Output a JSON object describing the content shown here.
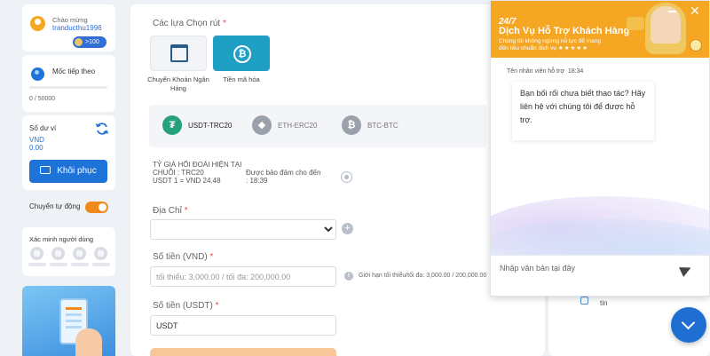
{
  "user": {
    "greeting": "Chào mừng",
    "username": "tranducthu1996",
    "vip_badge": ">100"
  },
  "milestone": {
    "label": "Mốc tiếp theo",
    "progress_text": "0 / 50000",
    "progress_fraction": 0
  },
  "wallet": {
    "label": "Số dư ví",
    "currency": "VND",
    "amount": "0.00",
    "restore_label": "Khôi phục"
  },
  "auto_transfer": {
    "label": "Chuyển tự động",
    "enabled": true
  },
  "verification": {
    "label": "Xác minh người dùng"
  },
  "withdraw": {
    "choose_label": "Các lựa Chọn rút",
    "required_mark": "*",
    "methods": [
      {
        "label": "Chuyển Khoản Ngân Hàng",
        "icon": "bank-icon",
        "active": false
      },
      {
        "label": "Tiền mã hóa",
        "icon": "bitcoin-icon",
        "active": true
      }
    ],
    "chains": [
      {
        "label": "USDT-TRC20",
        "icon": "tether-icon",
        "symbol": "₮",
        "color": "#26a17b"
      },
      {
        "label": "ETH-ERC20",
        "icon": "ethereum-icon",
        "symbol": "◆",
        "color": "#9aa1ab"
      },
      {
        "label": "BTC-BTC",
        "icon": "bitcoin-icon",
        "symbol": "₿",
        "color": "#9aa1ab"
      }
    ],
    "rate_title": "TỶ GIÁ HỐI ĐOÁI HIỆN TẠI",
    "rate_chain": "CHUỖI : TRC20",
    "rate_value": "USDT 1 = VND 24.48",
    "guarantee_label": "Được bảo đảm cho đến",
    "guarantee_time": ": 18:39",
    "address_label": "Địa Chỉ",
    "amount_vnd_label": "Số tiền (VND)",
    "amount_vnd_placeholder": "tối thiểu: 3,000.00 / tối đa: 200,000.00",
    "limits_text": "Giới hạn tối thiểu/tối đa: 3,000.00 / 200,000.00",
    "amount_usdt_label": "Số tiền (USDT)",
    "amount_usdt_value": "USDT"
  },
  "right_card": {
    "partial_text": "tin"
  },
  "chat": {
    "tagline": "24/7",
    "title": "Dịch Vụ Hỗ Trợ Khách Hàng",
    "subtitle": "Chúng tôi không ngừng nỗ lực để mang đến tiêu chuẩn dịch vụ",
    "stars": "★★★★★",
    "minimize_icon": "minimize-icon",
    "close_symbol": "✕",
    "agent_label": "Tên nhân viên hỗ trợ",
    "agent_time": "18:34",
    "message": "Bạn bối rối chưa biết thao tác? Hãy liên hệ với chúng tôi để được hỗ trợ.",
    "input_placeholder": "Nhập văn bản tại đây"
  },
  "colors": {
    "primary": "#1e73d8",
    "accent": "#f08a1c",
    "chat_header": "#f5a623",
    "crypto_active": "#1f9fc4"
  }
}
